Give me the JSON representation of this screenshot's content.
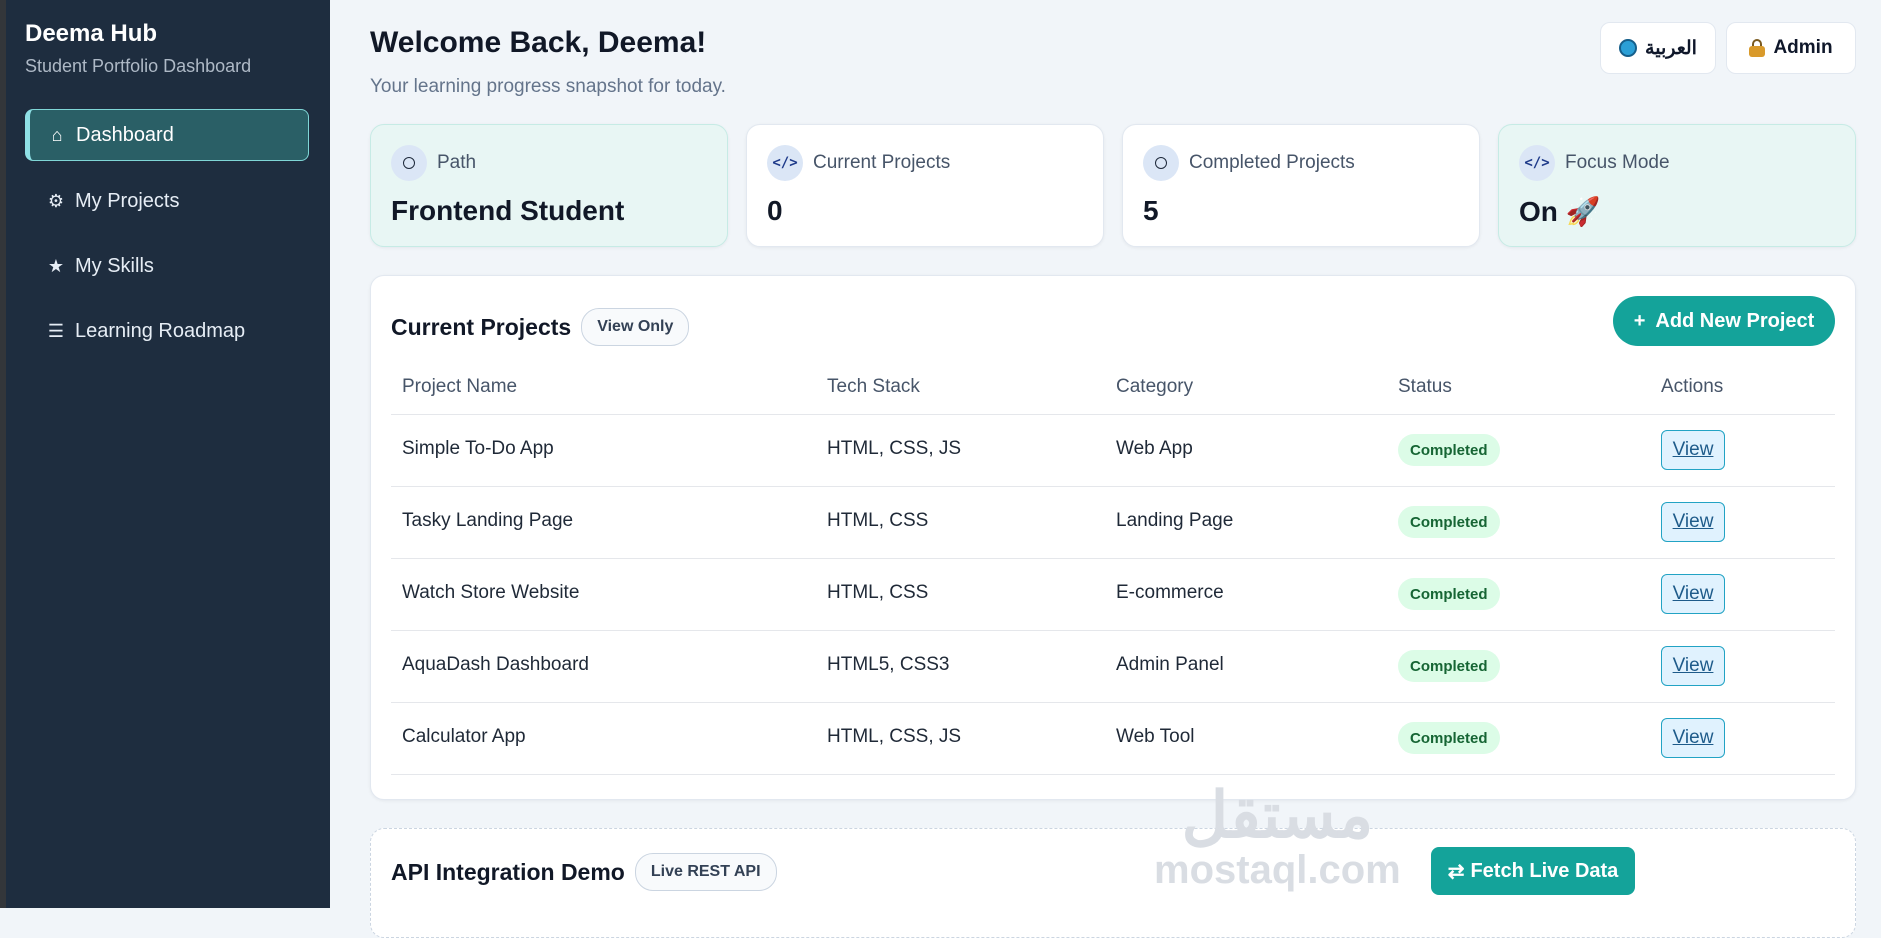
{
  "sidebar": {
    "brand_title": "Deema Hub",
    "brand_subtitle": "Student Portfolio Dashboard",
    "items": [
      {
        "label": "Dashboard",
        "icon": "home-icon",
        "glyph": "⌂",
        "active": true
      },
      {
        "label": "My Projects",
        "icon": "gear-icon",
        "glyph": "⚙",
        "active": false
      },
      {
        "label": "My Skills",
        "icon": "star-icon",
        "glyph": "★",
        "active": false
      },
      {
        "label": "Learning Roadmap",
        "icon": "list-icon",
        "glyph": "☰",
        "active": false
      }
    ]
  },
  "header": {
    "title": "Welcome Back, Deema!",
    "subtitle": "Your learning progress snapshot for today.",
    "language_button": "العربية",
    "admin_button": "Admin"
  },
  "stats": [
    {
      "label": "Path",
      "value": "Frontend Student",
      "icon": "circle-icon"
    },
    {
      "label": "Current Projects",
      "value": "0",
      "icon": "code-icon",
      "glyph": "</>"
    },
    {
      "label": "Completed Projects",
      "value": "5",
      "icon": "circle-icon"
    },
    {
      "label": "Focus Mode",
      "value": "On 🚀",
      "icon": "code-icon",
      "glyph": "</>"
    }
  ],
  "projects": {
    "title": "Current Projects",
    "badge": "View Only",
    "add_button": "Add New Project",
    "add_button_icon": "+",
    "columns": [
      "Project Name",
      "Tech Stack",
      "Category",
      "Status",
      "Actions"
    ],
    "rows": [
      {
        "name": "Simple To-Do App",
        "stack": "HTML, CSS, JS",
        "category": "Web App",
        "status": "Completed",
        "action": "View"
      },
      {
        "name": "Tasky Landing Page",
        "stack": "HTML, CSS",
        "category": "Landing Page",
        "status": "Completed",
        "action": "View"
      },
      {
        "name": "Watch Store Website",
        "stack": "HTML, CSS",
        "category": "E-commerce",
        "status": "Completed",
        "action": "View"
      },
      {
        "name": "AquaDash Dashboard",
        "stack": "HTML5, CSS3",
        "category": "Admin Panel",
        "status": "Completed",
        "action": "View"
      },
      {
        "name": "Calculator App",
        "stack": "HTML, CSS, JS",
        "category": "Web Tool",
        "status": "Completed",
        "action": "View"
      }
    ]
  },
  "api": {
    "title": "API Integration Demo",
    "badge": "Live REST API",
    "fetch_button": "Fetch Live Data",
    "fetch_icon": "⇄"
  },
  "watermark": {
    "arabic": "مستقل",
    "latin": "mostaql.com"
  },
  "colors": {
    "sidebar_bg": "#1e2d3f",
    "accent": "#14a39a",
    "status_bg": "#dcfce7",
    "status_text": "#166534"
  }
}
